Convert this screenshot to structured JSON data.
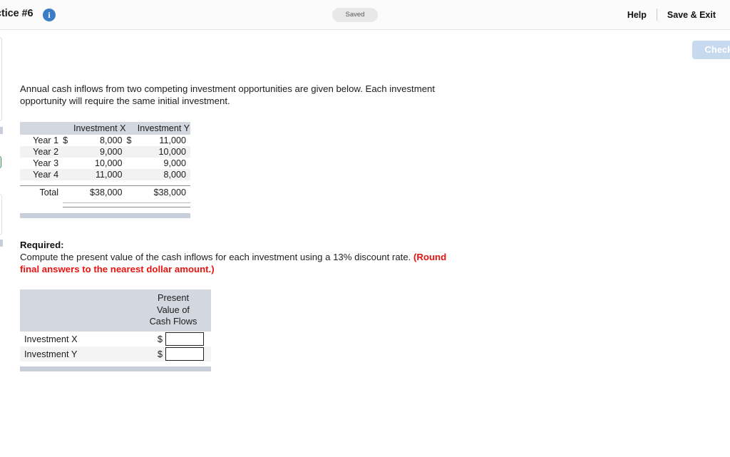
{
  "topbar": {
    "title": "ctice #6",
    "info_icon": "info-icon",
    "saved_label": "Saved",
    "help_label": "Help",
    "save_exit_label": "Save & Exit"
  },
  "actions": {
    "check_label": "Check"
  },
  "question": {
    "prompt": "Annual cash inflows from two competing investment opportunities are given below. Each investment opportunity will require the same initial investment."
  },
  "cashflow_table": {
    "columns": [
      "",
      "Investment X",
      "Investment Y"
    ],
    "rows": [
      {
        "label": "Year 1",
        "x": "8,000",
        "y": "11,000",
        "currency": "$"
      },
      {
        "label": "Year 2",
        "x": "9,000",
        "y": "10,000",
        "currency": ""
      },
      {
        "label": "Year 3",
        "x": "10,000",
        "y": "9,000",
        "currency": ""
      },
      {
        "label": "Year 4",
        "x": "11,000",
        "y": "8,000",
        "currency": ""
      }
    ],
    "total": {
      "label": "Total",
      "x": "$38,000",
      "y": "$38,000"
    }
  },
  "required": {
    "heading": "Required:",
    "body": "Compute the present value of the cash inflows for each investment using a 13% discount rate. ",
    "note": "(Round final answers to the nearest dollar amount.)"
  },
  "answer_table": {
    "header_lines": [
      "Present",
      "Value of",
      "Cash Flows"
    ],
    "rows": [
      {
        "label": "Investment X",
        "currency": "$",
        "value": "",
        "placeholder": ""
      },
      {
        "label": "Investment Y",
        "currency": "$",
        "value": "",
        "placeholder": ""
      }
    ]
  }
}
